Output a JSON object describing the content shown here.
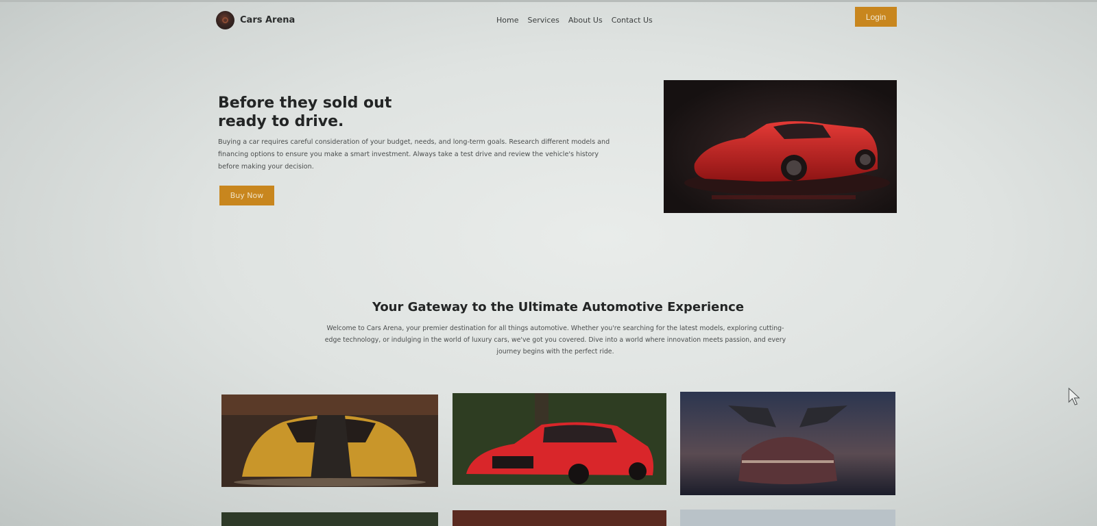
{
  "header": {
    "brand": "Cars Arena",
    "nav": [
      "Home",
      "Services",
      "About Us",
      "Contact Us"
    ],
    "login_label": "Login",
    "accent_color": "#c8861e"
  },
  "hero": {
    "title_line1": "Before they sold out",
    "title_line2": "ready to drive.",
    "description": "Buying a car requires careful consideration of your budget, needs, and long-term goals. Research different models and financing options to ensure you make a smart investment. Always take a test drive and review the vehicle's history before making your decision.",
    "button_label": "Buy Now",
    "image": "red-sports-car-photo"
  },
  "gateway": {
    "title": "Your Gateway to the Ultimate Automotive Experience",
    "description": "Welcome to Cars Arena, your premier destination for all things automotive. Whether you're searching for the latest models, exploring cutting-edge technology, or indulging in the world of luxury cars, we've got you covered. Dive into a world where innovation meets passion, and every journey begins with the perfect ride.",
    "gallery": [
      "yellow-supercar-photo",
      "red-mercedes-amg-photo",
      "gullwing-concept-car-photo",
      "car-photo",
      "car-photo",
      "car-photo"
    ]
  }
}
